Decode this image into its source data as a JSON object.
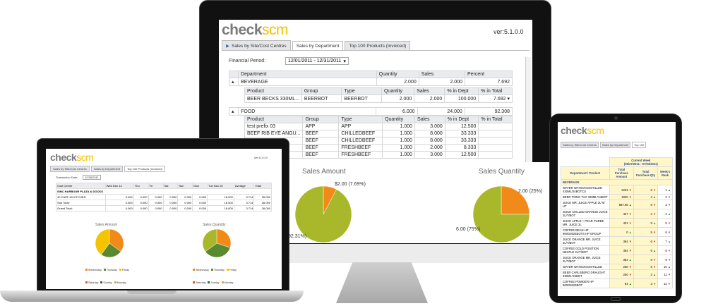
{
  "monitor": {
    "app": {
      "logo_check": "check",
      "logo_scm": "scm",
      "version": "ver:5.1.0.0"
    },
    "tabs": [
      {
        "label": "Sales by Site/Cost Centres"
      },
      {
        "label": "Sales by Department"
      },
      {
        "label": "Top 100 Products (Invoiced)"
      }
    ],
    "financial_period_label": "Financial Period:",
    "financial_period_value": "12/01/2011 - 12/31/2011",
    "dept_headers": [
      "Department",
      "Quantity",
      "Sales",
      "Percent"
    ],
    "beverage": {
      "name": "BEVERAGE",
      "quantity": "2.000",
      "sales": "2.000",
      "percent": "7.692"
    },
    "product_headers": [
      "Product",
      "Group",
      "Type",
      "Quantity",
      "Sales",
      "% in Dept",
      "% in Total"
    ],
    "beverage_rows": [
      {
        "product": "BEER BECKS 330ML...",
        "group": "BEERBOT",
        "type": "BEERBOT",
        "quantity": "2.000",
        "sales": "2.000",
        "pct_dept": "100.000",
        "pct_total": "7.692"
      }
    ],
    "food": {
      "name": "FOOD",
      "quantity": "6.000",
      "sales": "24.000",
      "percent": "92.308"
    },
    "food_rows": [
      {
        "product": "test prefix 03",
        "group": "APP",
        "type": "APP",
        "quantity": "1.000",
        "sales": "3.000",
        "pct_dept": "12.500"
      },
      {
        "product": "BEEF RIB EYE ANGU...",
        "group": "BEEF",
        "type": "CHILLEDBEEF",
        "quantity": "1.000",
        "sales": "8.000",
        "pct_dept": "33.333"
      },
      {
        "product": "",
        "group": "BEEF",
        "type": "CHILLEDBEEF",
        "quantity": "1.000",
        "sales": "8.000",
        "pct_dept": "33.333"
      },
      {
        "product": "",
        "group": "BEEF",
        "type": "FRESHBEEF",
        "quantity": "1.000",
        "sales": "2.000",
        "pct_dept": "8.333"
      },
      {
        "product": "",
        "group": "BEEF",
        "type": "FRESHBEEF",
        "quantity": "1.000",
        "sales": "3.000",
        "pct_dept": "12.500"
      }
    ],
    "pie_sales": {
      "title": "Sales Amount",
      "small_label": "$2.00 (7.69%)",
      "big_label": "92.31%)"
    },
    "pie_qty": {
      "title": "Sales Quantity",
      "small_label": "2.00 (25%)",
      "big_label": "6.00 (75%)"
    }
  },
  "chart_data": [
    {
      "type": "pie",
      "title": "Sales Amount",
      "categories": [
        "BEVERAGE",
        "FOOD"
      ],
      "values": [
        7.69,
        92.31
      ]
    },
    {
      "type": "pie",
      "title": "Sales Quantity",
      "categories": [
        "BEVERAGE",
        "FOOD"
      ],
      "values": [
        25,
        75
      ]
    }
  ],
  "laptop": {
    "logo_check": "check",
    "logo_scm": "scm",
    "version": "ver:5.1.0.0",
    "tabs": [
      "Sales by Site/Cost Centres",
      "Sales by Department",
      "Top 100 Products (Invoiced)"
    ],
    "transaction_label": "Transaction Date:",
    "transaction_value": "12/28/2011",
    "headers": [
      "Cost Centre",
      "Wed Dec 14",
      "Thu",
      "Fri",
      "Sat",
      "Sun",
      "Mon",
      "Tue Dec 20",
      "Average",
      "Total"
    ],
    "group_row": "SINC HARBOUR PLAZA & DOCKS",
    "rows": [
      {
        "name": "40 CAFE 40 KITCHEN",
        "vals": [
          "0.000",
          "0.000",
          "0.000",
          "0.000",
          "0.000",
          "0.000",
          "18.000",
          "3.714",
          "26.000"
        ]
      },
      {
        "name": "Sub Total:",
        "vals": [
          "0.000",
          "0.000",
          "0.000",
          "0.000",
          "0.000",
          "0.000",
          "18.000",
          "3.714",
          "26.000"
        ]
      },
      {
        "name": "Grand Total:",
        "vals": [
          "0.000",
          "0.000",
          "0.000",
          "0.000",
          "0.000",
          "0.000",
          "18.000",
          "3.714",
          "26.000"
        ]
      }
    ],
    "pie1_title": "Sales Amount",
    "pie2_title": "Sales Quantity",
    "legend1": [
      "Wednesday",
      "Thursday",
      "Friday",
      "Saturday",
      "Sunday",
      "Monday",
      "Tuesday"
    ],
    "legend2": [
      "Wednesday",
      "Thursday",
      "Friday",
      "Saturday",
      "Sunday",
      "Monday",
      "Tuesday"
    ]
  },
  "tablet": {
    "logo_check": "check",
    "logo_scm": "scm",
    "tabs": [
      "Sales by Site/Cost Centres",
      "Sales by Department",
      "Top 100"
    ],
    "current_week_label": "Current Week",
    "current_week_range": "(06/27/2011 - 07/03/2011)",
    "headers": [
      "Department / Product",
      "Total Purchase Amount",
      "Total Purchase Qty",
      "Week's Rank"
    ],
    "group": "BEVERAGE",
    "rows": [
      {
        "name": "WATER WATSON DISTILLED 430ML/24BOTCS",
        "amount": "2223",
        "qty": "6",
        "rank": "1"
      },
      {
        "name": "BEER TSING TAO 330ML*24BOT",
        "amount": "1920",
        "qty": "4",
        "rank": "2"
      },
      {
        "name": "JUICE MR. JUICE APPLE 2L*6/ UT",
        "amount": "867.08",
        "qty": "6",
        "rank": "3"
      },
      {
        "name": "JUICE CHILLED ORANGE JUICE 2L/T/BOT",
        "amount": "427",
        "qty": "4",
        "rank": "4"
      },
      {
        "name": "JUICE APPLE + PEAR PUREE MR. JUICE 2L",
        "amount": "421",
        "qty": "5",
        "rank": "5"
      },
      {
        "name": "COFFEE BEAN HP 900GM/24BOTS HP GROUP",
        "amount": "0",
        "qty": "5",
        "rank": "6"
      },
      {
        "name": "JUICE ORANGE MR. JUICE 2L/T/BOT",
        "amount": "364",
        "qty": "6",
        "rank": "7"
      },
      {
        "name": "COFFEE GOLD POSITION NESTLE 2L/T/BOT",
        "amount": "364",
        "qty": "6",
        "rank": "8"
      },
      {
        "name": "JUICE ORANGE MR. JUICE 2L/T/BOT",
        "amount": "364",
        "qty": "6",
        "rank": "9"
      },
      {
        "name": "WATER WATSON DISTILLED",
        "amount": "250",
        "qty": "5",
        "rank": "10"
      },
      {
        "name": "BEER CARLSBERG DRAUGHT 330ML*24BOT",
        "amount": "250",
        "qty": "3",
        "rank": "11"
      },
      {
        "name": "COFFEE POWDER HP 500GM/24BOT",
        "amount": "84",
        "qty": "3",
        "rank": "12"
      }
    ]
  }
}
